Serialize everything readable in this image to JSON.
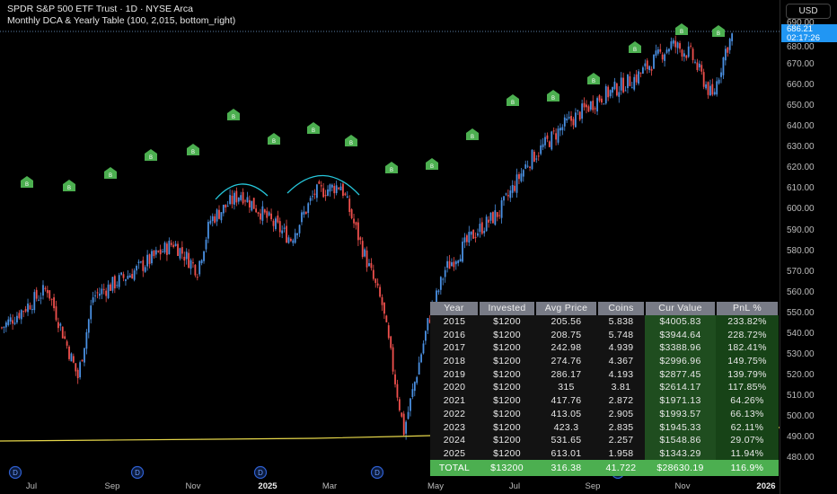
{
  "header": {
    "symbol_line": "SPDR S&P 500 ETF Trust · 1D · NYSE Arca",
    "indicator_line": "Monthly DCA & Yearly Table (100, 2,015, bottom_right)"
  },
  "axis": {
    "currency": "USD",
    "current_price": "686.21",
    "countdown": "02:17:26",
    "price_labels": [
      "690.00",
      "680.00",
      "670.00",
      "660.00",
      "650.00",
      "640.00",
      "630.00",
      "620.00",
      "610.00",
      "600.00",
      "590.00",
      "580.00",
      "570.00",
      "560.00",
      "550.00",
      "540.00",
      "530.00",
      "520.00",
      "510.00",
      "500.00",
      "490.00",
      "480.00"
    ]
  },
  "time_labels": [
    "Jul",
    "Sep",
    "Nov",
    "2025",
    "Mar",
    "May",
    "Jul",
    "Sep",
    "Nov",
    "2026"
  ],
  "colors": {
    "up": "#4a90e2",
    "down": "#f0504d",
    "buy_marker": "#4caf50",
    "avg_line": "#e6d74a",
    "arc": "#26c6da"
  },
  "price_keyframes": [
    [
      0,
      543
    ],
    [
      21,
      562
    ],
    [
      35,
      519
    ],
    [
      42,
      558
    ],
    [
      62,
      571
    ],
    [
      79,
      584
    ],
    [
      90,
      571
    ],
    [
      96,
      595
    ],
    [
      110,
      608
    ],
    [
      125,
      593
    ],
    [
      133,
      586
    ],
    [
      144,
      608
    ],
    [
      156,
      612
    ],
    [
      165,
      584
    ],
    [
      175,
      554
    ],
    [
      185,
      493
    ],
    [
      196,
      545
    ],
    [
      204,
      571
    ],
    [
      217,
      588
    ],
    [
      229,
      599
    ],
    [
      242,
      623
    ],
    [
      258,
      640
    ],
    [
      275,
      654
    ],
    [
      292,
      664
    ],
    [
      308,
      680
    ],
    [
      317,
      675
    ],
    [
      327,
      654
    ],
    [
      333,
      677
    ],
    [
      336,
      684
    ]
  ],
  "buy_marker_label": "B",
  "dividend_marker_label": "D",
  "table": {
    "headers": [
      "Year",
      "Invested",
      "Avg Price",
      "Coins",
      "Cur Value",
      "PnL %"
    ],
    "rows": [
      [
        "2015",
        "$1200",
        "205.56",
        "5.838",
        "$4005.83",
        "233.82%"
      ],
      [
        "2016",
        "$1200",
        "208.75",
        "5.748",
        "$3944.64",
        "228.72%"
      ],
      [
        "2017",
        "$1200",
        "242.98",
        "4.939",
        "$3388.96",
        "182.41%"
      ],
      [
        "2018",
        "$1200",
        "274.76",
        "4.367",
        "$2996.96",
        "149.75%"
      ],
      [
        "2019",
        "$1200",
        "286.17",
        "4.193",
        "$2877.45",
        "139.79%"
      ],
      [
        "2020",
        "$1200",
        "315",
        "3.81",
        "$2614.17",
        "117.85%"
      ],
      [
        "2021",
        "$1200",
        "417.76",
        "2.872",
        "$1971.13",
        "64.26%"
      ],
      [
        "2022",
        "$1200",
        "413.05",
        "2.905",
        "$1993.57",
        "66.13%"
      ],
      [
        "2023",
        "$1200",
        "423.3",
        "2.835",
        "$1945.33",
        "62.11%"
      ],
      [
        "2024",
        "$1200",
        "531.65",
        "2.257",
        "$1548.86",
        "29.07%"
      ],
      [
        "2025",
        "$1200",
        "613.01",
        "1.958",
        "$1343.29",
        "11.94%"
      ]
    ],
    "total": [
      "TOTAL",
      "$13200",
      "316.38",
      "41.722",
      "$28630.19",
      "116.9%"
    ]
  }
}
